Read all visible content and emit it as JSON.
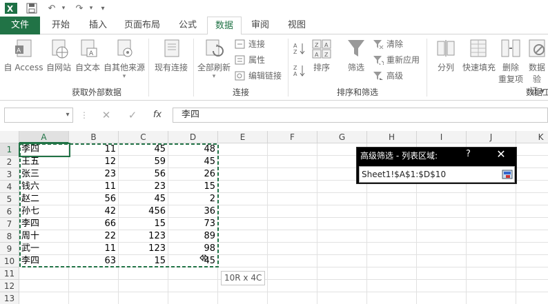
{
  "quick_access": {
    "excel_icon": "excel-icon",
    "save": "save-icon",
    "undo": "undo-icon",
    "redo": "redo-icon",
    "customize": "▾"
  },
  "tabs": [
    {
      "label": "文件"
    },
    {
      "label": "开始"
    },
    {
      "label": "插入"
    },
    {
      "label": "页面布局"
    },
    {
      "label": "公式"
    },
    {
      "label": "数据"
    },
    {
      "label": "审阅"
    },
    {
      "label": "视图"
    }
  ],
  "ribbon": {
    "get_external": {
      "buttons": [
        "自 Access",
        "自网站",
        "自文本",
        "自其他来源",
        "现有连接"
      ],
      "group_label": "获取外部数据"
    },
    "connections": {
      "refresh_all": "全部刷新",
      "small": [
        "连接",
        "属性",
        "编辑链接"
      ],
      "group_label": "连接"
    },
    "sort_filter": {
      "sort": "排序",
      "filter": "筛选",
      "small": [
        "清除",
        "重新应用",
        "高级"
      ],
      "group_label": "排序和筛选"
    },
    "data_tools": {
      "split": "分列",
      "flash_fill": "快速填充",
      "remove_dup_1": "删除",
      "remove_dup_2": "重复项",
      "validation_1": "数据验",
      "validation_2": "证 ▾",
      "group_label": "数据工"
    }
  },
  "formula_bar": {
    "name_box": "",
    "cancel": "✕",
    "enter": "✓",
    "fx": "fx",
    "content": "李四"
  },
  "columns": [
    "A",
    "B",
    "C",
    "D",
    "E",
    "F",
    "G",
    "H",
    "I",
    "J",
    "K"
  ],
  "rows": [
    "1",
    "2",
    "3",
    "4",
    "5",
    "6",
    "7",
    "8",
    "9",
    "10",
    "11",
    "12",
    "13"
  ],
  "table": [
    [
      "李四",
      "11",
      "45",
      "48"
    ],
    [
      "王五",
      "12",
      "59",
      "45"
    ],
    [
      "张三",
      "23",
      "56",
      "26"
    ],
    [
      "钱六",
      "11",
      "23",
      "15"
    ],
    [
      "赵二",
      "56",
      "45",
      "2"
    ],
    [
      "孙七",
      "42",
      "456",
      "36"
    ],
    [
      "李四",
      "66",
      "15",
      "73"
    ],
    [
      "周十",
      "22",
      "123",
      "89"
    ],
    [
      "武一",
      "11",
      "123",
      "98"
    ],
    [
      "李四",
      "63",
      "15",
      "45"
    ]
  ],
  "dialog": {
    "title": "高级筛选 - 列表区域:",
    "help": "?",
    "close": "✕",
    "value": "Sheet1!$A$1:$D$10"
  },
  "tooltip": "10R x 4C",
  "colors": {
    "accent": "#217346",
    "header_bg": "#f3f3f3"
  }
}
